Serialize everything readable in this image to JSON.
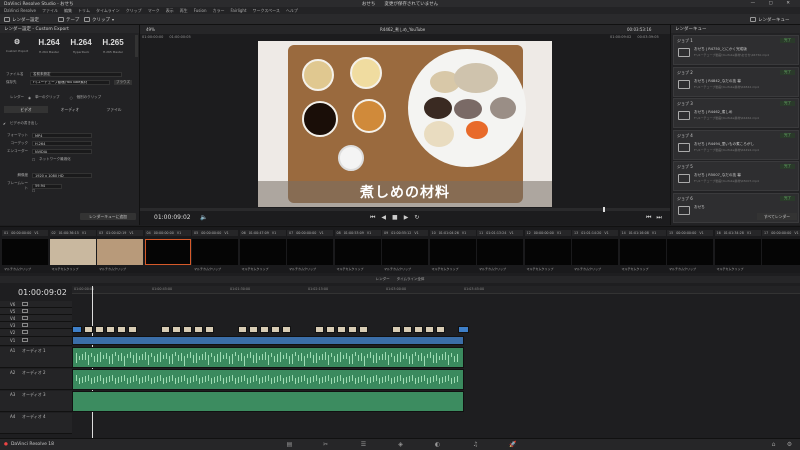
{
  "window": {
    "title": "DaVinci Resolve Studio - おせち",
    "center_title": "おせち　　変更が保存されていません"
  },
  "menu": [
    "DaVinci Resolve",
    "ファイル",
    "編集",
    "トリム",
    "タイムライン",
    "クリップ",
    "マーク",
    "表示",
    "再生",
    "Fusion",
    "カラー",
    "Fairlight",
    "ワークスペース",
    "ヘルプ"
  ],
  "toolbar": {
    "render_settings": "レンダー設定",
    "tape": "テープ",
    "clip": "クリップ",
    "render_queue": "レンダーキュー"
  },
  "left": {
    "header": "レンダー設定 - Custom Export",
    "presets": [
      {
        "big": "",
        "label": "Custom Export"
      },
      {
        "big": "H.264",
        "label": "H.264 Master"
      },
      {
        "big": "H.264",
        "label": "HyperDeck"
      },
      {
        "big": "H.265",
        "label": "H.265 Master"
      }
    ],
    "file_name_label": "ファイル名",
    "file_name": "名前未設定",
    "location_label": "保存先",
    "location": "F:\\ユーチューブ動画\\YouTube素材",
    "browse": "ブラウズ",
    "render_label": "レンダー",
    "render_single": "単一のクリップ",
    "render_individual": "個別のクリップ",
    "tabs": [
      "ビデオ",
      "オーディオ",
      "ファイル"
    ],
    "export_video": "ビデオの書き出し",
    "format_label": "フォーマット",
    "format": "MP4",
    "codec_label": "コーデック",
    "codec": "H.264",
    "encoder_label": "エンコーダー",
    "encoder": "NVIDIA",
    "network_opt": "ネットワーク最適化",
    "resolution_label": "解像度",
    "resolution": "1920 x 1080 HD",
    "fps_label": "フレームレート",
    "fps": "59.94",
    "quality_label": "",
    "quality": "",
    "add_queue": "レンダーキューに追加"
  },
  "viewer": {
    "zoom": "49%",
    "timecode_left": "01:00:00:00",
    "timecode_left2": "01:00:00:05",
    "clip_name": "R4462_煮しめ_YouTube",
    "duration": "00:03:53:16",
    "tc_right": "01:00:09:02",
    "tc_right2": "00:03:39:05",
    "subtitle": "煮しめの材料",
    "current": "01:00:09:02"
  },
  "queue": {
    "header": "レンダーキュー",
    "jobs": [
      {
        "job": "ジョブ 1",
        "status": "完了",
        "t1": "おせち | R4750_とにかく完成版",
        "t2": "F:\\ユーチューブ動画\\YouTube素材\\おせち\\R4750.mp4"
      },
      {
        "job": "ジョブ 2",
        "status": "完了",
        "t1": "おせち | R4842_なだの技 幕",
        "t2": "F:\\ユーチューブ動画\\YouTube素材\\R4842.mp4"
      },
      {
        "job": "ジョブ 3",
        "status": "完了",
        "t1": "おせち | R4462_煮しめ",
        "t2": "F:\\ユーチューブ動画\\YouTube素材\\R4462.mp4"
      },
      {
        "job": "ジョブ 4",
        "status": "完了",
        "t1": "おせち | R4494_里いもの煮ころがし",
        "t2": "F:\\ユーチューブ動画\\YouTube素材\\R4494.mp4"
      },
      {
        "job": "ジョブ 5",
        "status": "完了",
        "t1": "おせち | R5007_なだの技 幕",
        "t2": "F:\\ユーチューブ動画\\YouTube素材\\R5007.mp4"
      },
      {
        "job": "ジョブ 6",
        "status": "完了",
        "t1": "おせち",
        "t2": ""
      }
    ],
    "render_all": "すべてレンダー"
  },
  "clips": [
    {
      "n": "01",
      "tc": "00:00:00:00",
      "v": "V1",
      "label": "マルチカムクリップ"
    },
    {
      "n": "02",
      "tc": "01:00:36:15",
      "v": "V1",
      "label": "マルチカムクリップ"
    },
    {
      "n": "03",
      "tc": "01:00:02:19",
      "v": "V1",
      "label": "マルチカムクリップ"
    },
    {
      "n": "04",
      "tc": "00:00:00:00",
      "v": "V1",
      "label": ""
    },
    {
      "n": "05",
      "tc": "00:00:00:00",
      "v": "V1",
      "label": "マルチカムクリップ"
    },
    {
      "n": "06",
      "tc": "01:00:47:09",
      "v": "V1",
      "label": "マルチカムクリップ"
    },
    {
      "n": "07",
      "tc": "00:00:00:00",
      "v": "V1",
      "label": "マルチカムクリップ"
    },
    {
      "n": "08",
      "tc": "01:00:53:09",
      "v": "V1",
      "label": "マルチカムクリップ"
    },
    {
      "n": "09",
      "tc": "01:00:55:12",
      "v": "V1",
      "label": "マルチカムクリップ"
    },
    {
      "n": "10",
      "tc": "01:01:04:26",
      "v": "V1",
      "label": "マルチカムクリップ"
    },
    {
      "n": "11",
      "tc": "01:01:13:24",
      "v": "V1",
      "label": "マルチカムクリップ"
    },
    {
      "n": "12",
      "tc": "00:00:00:00",
      "v": "V1",
      "label": "マルチカムクリップ"
    },
    {
      "n": "13",
      "tc": "01:01:14:20",
      "v": "V1",
      "label": "マルチカムクリップ"
    },
    {
      "n": "14",
      "tc": "01:01:16:08",
      "v": "V1",
      "label": "マルチカムクリップ"
    },
    {
      "n": "15",
      "tc": "00:00:00:00",
      "v": "V1",
      "label": "マルチカムクリップ"
    },
    {
      "n": "16",
      "tc": "01:01:34:28",
      "v": "V1",
      "label": "マルチカムクリップ"
    },
    {
      "n": "17",
      "tc": "00:00:00:00",
      "v": "V1",
      "label": ""
    }
  ],
  "timeline": {
    "header": "レンダー　　タイムライン全体",
    "tc": "01:00:09:02",
    "tracks": [
      {
        "name": "V6"
      },
      {
        "name": "V5"
      },
      {
        "name": "V4"
      },
      {
        "name": "V3"
      },
      {
        "name": "V2"
      },
      {
        "name": "V1"
      },
      {
        "name": "A1",
        "label": "オーディオ 1"
      },
      {
        "name": "A2",
        "label": "オーディオ 2"
      },
      {
        "name": "A3",
        "label": "オーディオ 3"
      },
      {
        "name": "A4",
        "label": "オーディオ 4"
      }
    ],
    "ruler": [
      "01:00:00:00",
      "01:00:45:00",
      "01:01:30:00",
      "01:02:15:00",
      "01:03:00:00",
      "01:03:45:00"
    ]
  },
  "bottom": {
    "app": "DaVinci Resolve 18"
  }
}
